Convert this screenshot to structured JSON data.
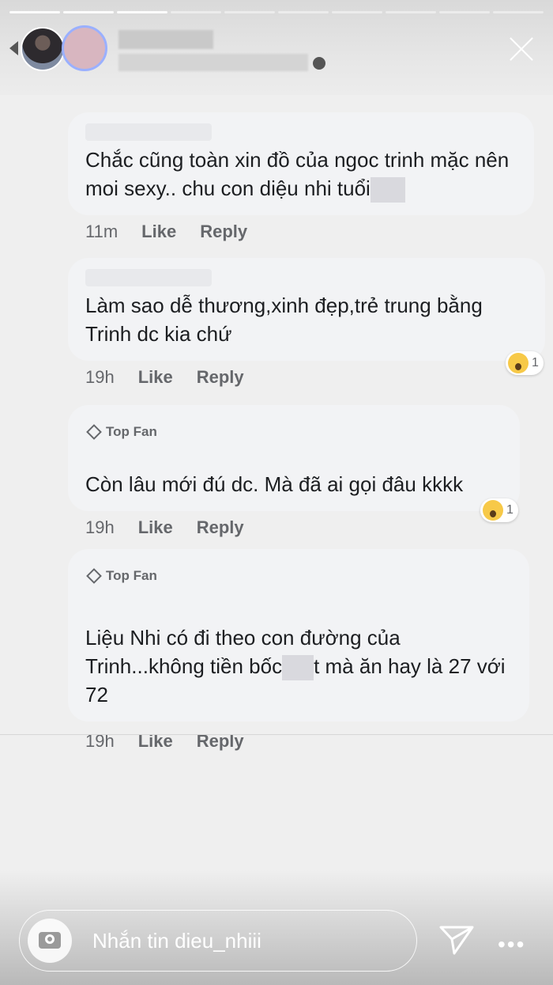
{
  "comments": [
    {
      "text": "Chắc cũng toàn xin đồ của ngoc trinh mặc nên moi sexy.. chu con diệu nhi tuổi",
      "time": "11m",
      "like": "Like",
      "reply": "Reply"
    },
    {
      "text": "Làm sao dễ thương,xinh đẹp,trẻ trung bằng Trinh dc kia chứ",
      "time": "19h",
      "like": "Like",
      "reply": "Reply",
      "reaction_count": "1"
    },
    {
      "badge": "Top Fan",
      "text": "Còn lâu mới đú dc. Mà đã ai gọi đâu kkkk",
      "time": "19h",
      "like": "Like",
      "reply": "Reply",
      "reaction_count": "1"
    },
    {
      "badge": "Top Fan",
      "text_a": "Liệu Nhi có đi theo con đường của Trinh...không tiền bốc",
      "text_b": "t mà ăn hay là 27 với 72",
      "time": "19h",
      "like": "Like",
      "reply": "Reply"
    }
  ],
  "composer": {
    "placeholder": "Nhắn tin dieu_nhiii"
  }
}
